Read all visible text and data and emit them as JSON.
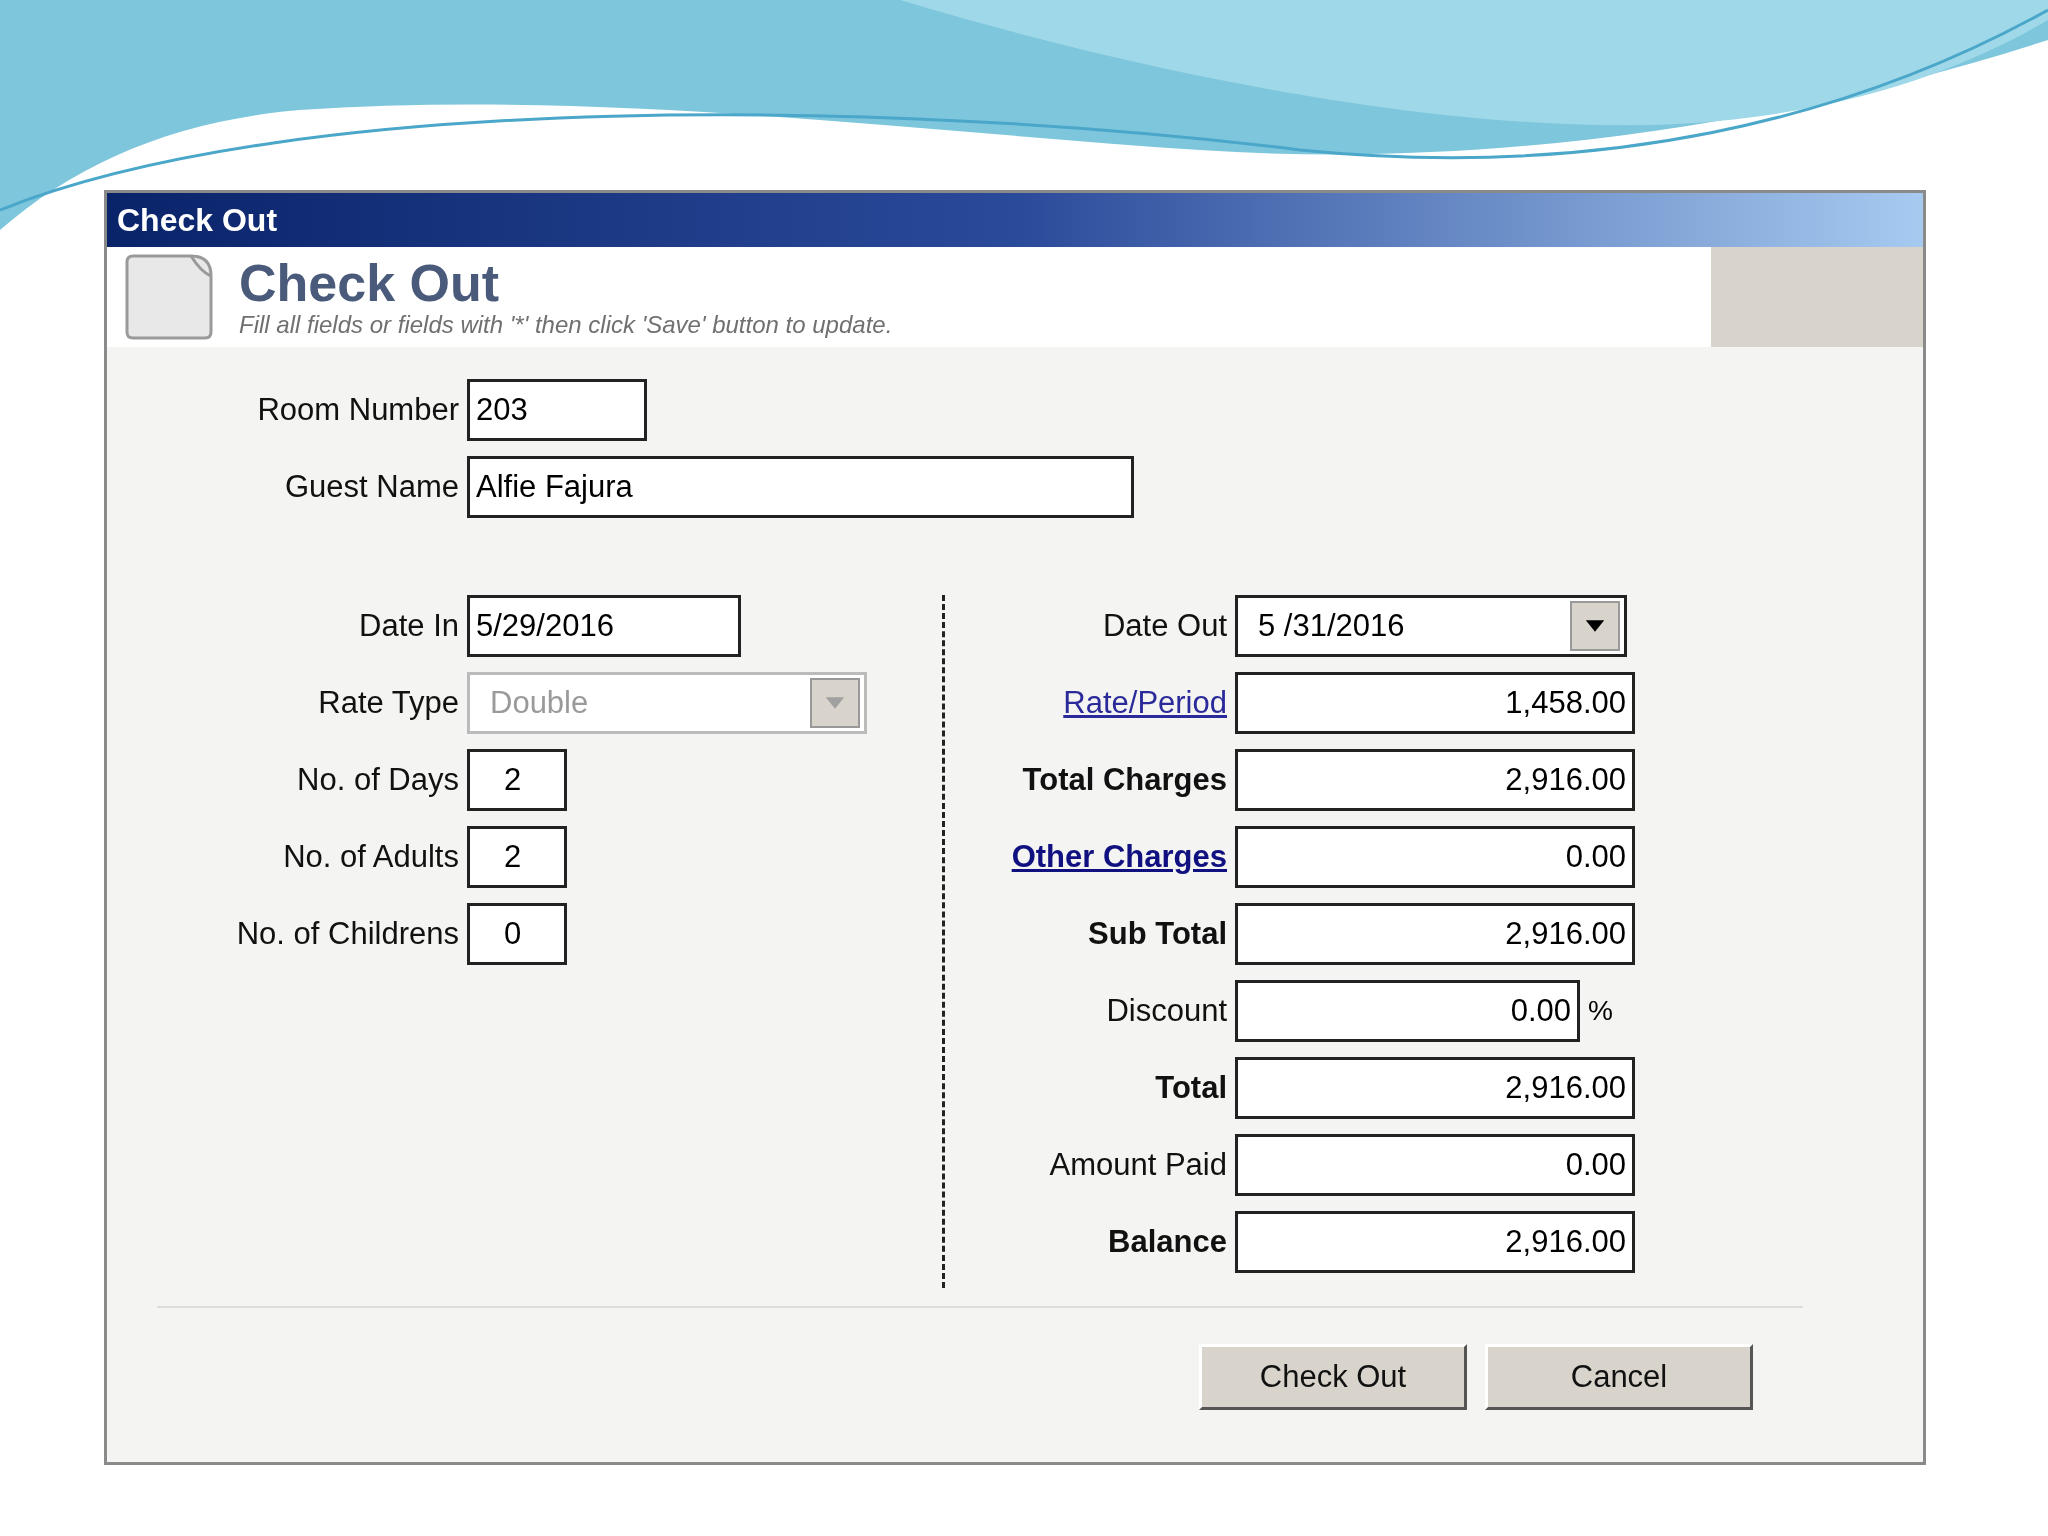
{
  "window": {
    "title": "Check Out"
  },
  "header": {
    "title": "Check Out",
    "subtitle": "Fill all fields or fields with '*' then click 'Save' button to update."
  },
  "top_fields": [
    {
      "label": "Room Number",
      "value": "203",
      "kind": "short"
    },
    {
      "label": "Guest Name",
      "value": "Alfie Fajura",
      "kind": "wide"
    }
  ],
  "left_fields": [
    {
      "label": "Date In",
      "value": "5/29/2016",
      "kind": "date",
      "disabled": false
    },
    {
      "label": "Rate Type",
      "value": "Double",
      "kind": "combo",
      "disabled": true
    },
    {
      "label": "No. of Days",
      "value": "2",
      "kind": "count",
      "disabled": false
    },
    {
      "label": "No. of Adults",
      "value": "2",
      "kind": "count",
      "disabled": false
    },
    {
      "label": "No. of Childrens",
      "value": "0",
      "kind": "count",
      "disabled": false
    }
  ],
  "right_fields": [
    {
      "label": "Date Out",
      "bold": false,
      "link": false,
      "value": "5 /31/2016",
      "kind": "combo"
    },
    {
      "label": "Rate/Period",
      "bold": false,
      "link": true,
      "value": "1,458.00",
      "kind": "amount"
    },
    {
      "label": "Total Charges",
      "bold": true,
      "link": false,
      "value": "2,916.00",
      "kind": "amount"
    },
    {
      "label": "Other Charges",
      "bold": true,
      "link": true,
      "value": "0.00",
      "kind": "amount"
    },
    {
      "label": "Sub Total",
      "bold": true,
      "link": false,
      "value": "2,916.00",
      "kind": "amount"
    },
    {
      "label": "Discount",
      "bold": false,
      "link": false,
      "value": "0.00",
      "kind": "percent",
      "suffix": "%"
    },
    {
      "label": "Total",
      "bold": true,
      "link": false,
      "value": "2,916.00",
      "kind": "amount"
    },
    {
      "label": "Amount Paid",
      "bold": false,
      "link": false,
      "value": "0.00",
      "kind": "amount"
    },
    {
      "label": "Balance",
      "bold": true,
      "link": false,
      "value": "2,916.00",
      "kind": "amount"
    }
  ],
  "buttons": [
    "Check Out",
    "Cancel"
  ]
}
